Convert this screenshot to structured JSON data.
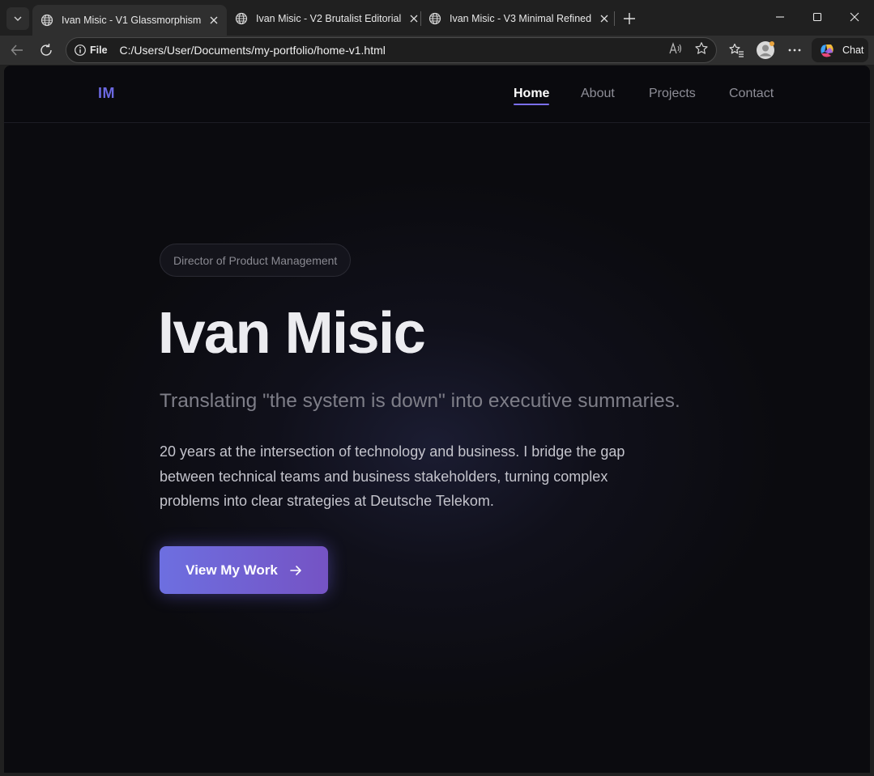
{
  "browser": {
    "tabs": [
      {
        "title": "Ivan Misic - V1 Glassmorphism",
        "active": true
      },
      {
        "title": "Ivan Misic - V2 Brutalist Editorial",
        "active": false
      },
      {
        "title": "Ivan Misic - V3 Minimal Refined",
        "active": false
      }
    ],
    "address": {
      "scheme": "File",
      "url": "C:/Users/User/Documents/my-portfolio/home-v1.html"
    },
    "chat_label": "Chat"
  },
  "site": {
    "logo": "IM",
    "nav": [
      {
        "label": "Home",
        "active": true
      },
      {
        "label": "About",
        "active": false
      },
      {
        "label": "Projects",
        "active": false
      },
      {
        "label": "Contact",
        "active": false
      }
    ],
    "hero": {
      "role": "Director of Product Management",
      "name": "Ivan Misic",
      "tagline": "Translating \"the system is down\" into executive summaries.",
      "bio": "20 years at the intersection of technology and business. I bridge the gap between technical teams and business stakeholders, turning complex problems into clear strategies at Deutsche Telekom.",
      "cta_label": "View My Work"
    }
  },
  "colors": {
    "accent": "#7b6ff0",
    "logo": "#6b68e0",
    "page_background": "#0b0b0f"
  }
}
